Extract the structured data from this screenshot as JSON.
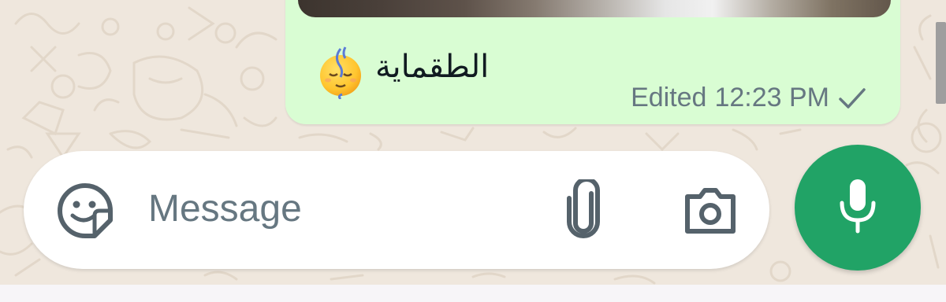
{
  "message": {
    "caption": "الطقماية",
    "emoji": "relieved-face-emoji",
    "status": "Edited",
    "time": "12:23 PM",
    "delivery_icon": "single-check-icon"
  },
  "composer": {
    "placeholder": "Message",
    "sticker_icon": "sticker-icon",
    "attach_icon": "paperclip-icon",
    "camera_icon": "camera-icon",
    "voice_icon": "microphone-icon"
  },
  "colors": {
    "wallpaper": "#efe7dd",
    "bubble": "#d9fdd3",
    "mic_button": "#21a366",
    "icon_gray": "#55626b",
    "meta_gray": "#667781"
  }
}
